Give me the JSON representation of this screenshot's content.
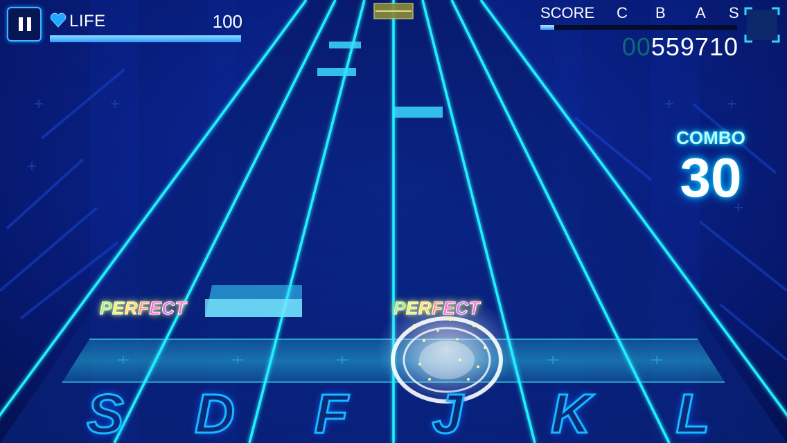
{
  "hud": {
    "pause_icon": "pause-icon",
    "life": {
      "icon": "heart-icon",
      "label": "LIFE",
      "value": "100",
      "fill_fraction": 1.0
    },
    "score": {
      "label": "SCORE",
      "ranks": [
        "C",
        "B",
        "A",
        "S"
      ],
      "progress_fraction": 0.07,
      "leading_zeros": "00",
      "digits": "559710"
    },
    "rank_icon": "rank-frame-icon",
    "combo": {
      "label": "COMBO",
      "value": "30"
    }
  },
  "judgements": [
    {
      "text": "PERFECT"
    },
    {
      "text": "PERFECT"
    }
  ],
  "keys": [
    "S",
    "D",
    "F",
    "J",
    "K",
    "L"
  ],
  "colors": {
    "lane_line": "#22f0ff",
    "note": "#39d9ff",
    "background": "#0a2185",
    "judge_line": "#1fb6d8"
  }
}
